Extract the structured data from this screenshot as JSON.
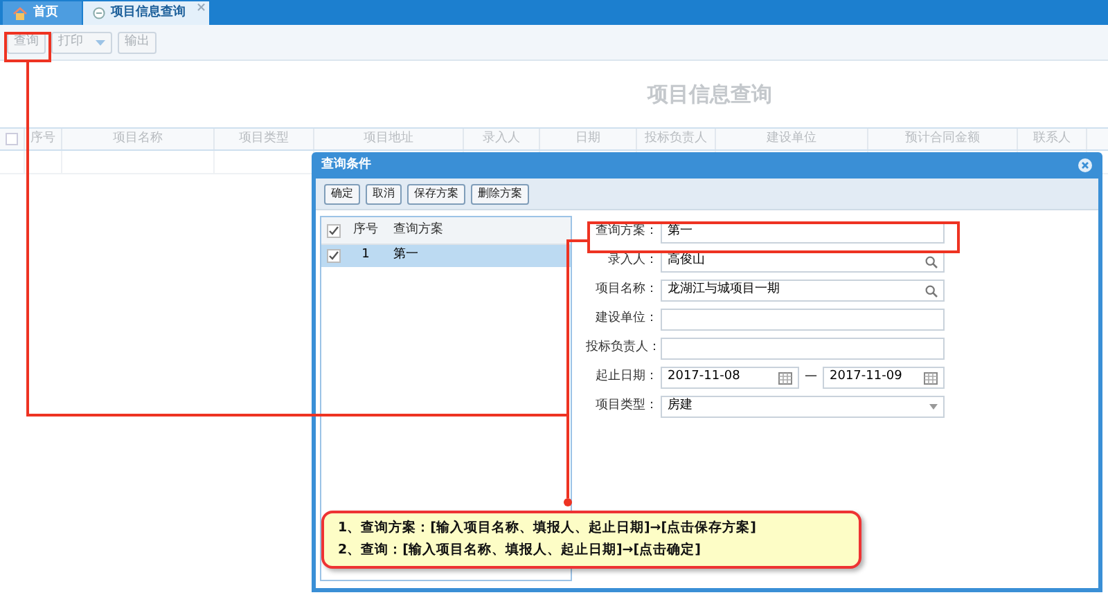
{
  "tabs": [
    {
      "label": "首页",
      "kind": "home",
      "selected": false
    },
    {
      "label": "项目信息查询",
      "kind": "page",
      "selected": true,
      "close": "×"
    }
  ],
  "toolbar": [
    {
      "label": "查询",
      "dropdown": false
    },
    {
      "label": "打印",
      "dropdown": true
    },
    {
      "label": "输出",
      "dropdown": false
    }
  ],
  "page_title": "项目信息查询",
  "table": {
    "all_checked": false,
    "columns": [
      "序号",
      "项目名称",
      "项目类型",
      "项目地址",
      "录入人",
      "日期",
      "投标负责人",
      "建设单位",
      "预计合同金额",
      "联系人"
    ]
  },
  "dialog": {
    "title": "查询条件",
    "buttons": [
      "确定",
      "取消",
      "保存方案",
      "删除方案"
    ],
    "scheme_list": {
      "columns": [
        "序号",
        "查询方案"
      ],
      "all_checked": true,
      "rows": [
        {
          "index": "1",
          "name": "第一",
          "checked": true,
          "selected": true
        }
      ]
    },
    "fields": [
      {
        "label": "查询方案：",
        "kind": "text",
        "value": "第一"
      },
      {
        "label": "录入人：",
        "kind": "search",
        "value": "高俊山"
      },
      {
        "label": "项目名称：",
        "kind": "search",
        "value": "龙湖江与城项目一期"
      },
      {
        "label": "建设单位：",
        "kind": "text"
      },
      {
        "label": "投标负责人：",
        "kind": "text"
      },
      {
        "label": "起止日期：",
        "kind": "date_range",
        "from": "2017-11-08",
        "separator": "—",
        "to": "2017-11-09"
      },
      {
        "label": "项目类型：",
        "kind": "select",
        "value": "房建"
      }
    ]
  },
  "callout": {
    "lines": [
      "1、查询方案：**[**输入项目名称、填报人、起止日期**]→[**点击保存方案**]**",
      "2、查询：**[**输入项目名称、填报人、起止日期**]→[**点击确定**]**"
    ]
  }
}
